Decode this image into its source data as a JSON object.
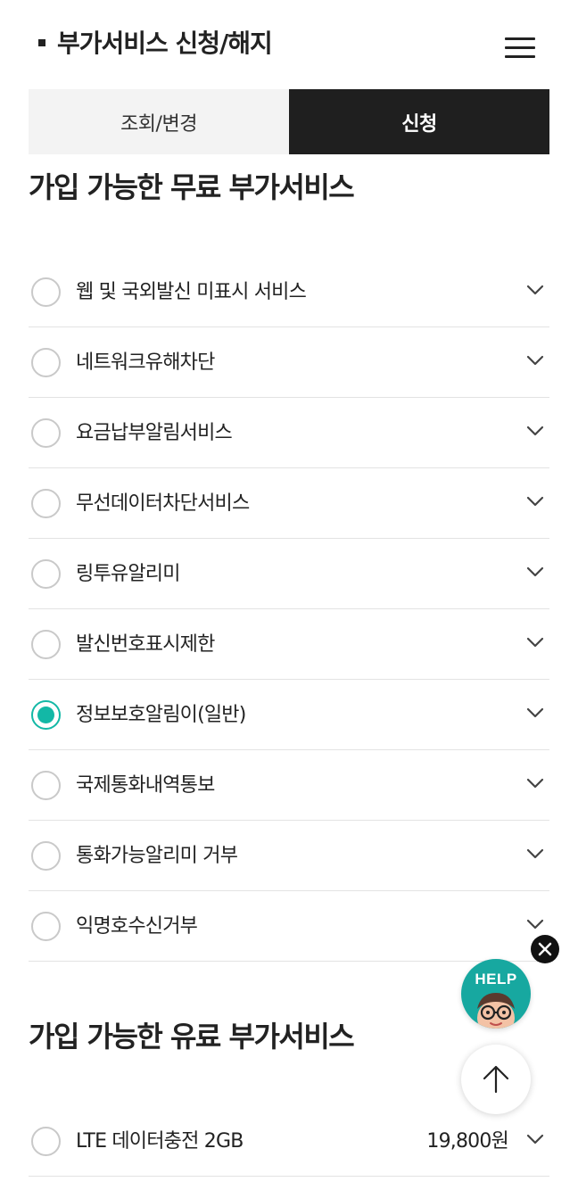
{
  "header": {
    "title": "부가서비스 신청/해지",
    "menu_icon": "hamburger-menu-icon"
  },
  "tabs": [
    {
      "label": "조회/변경",
      "active": false
    },
    {
      "label": "신청",
      "active": true
    }
  ],
  "free_section": {
    "title": "가입 가능한 무료 부가서비스",
    "items": [
      {
        "label": "웹 및 국외발신 미표시 서비스",
        "checked": false
      },
      {
        "label": "네트워크유해차단",
        "checked": false
      },
      {
        "label": "요금납부알림서비스",
        "checked": false
      },
      {
        "label": "무선데이터차단서비스",
        "checked": false
      },
      {
        "label": "링투유알리미",
        "checked": false
      },
      {
        "label": "발신번호표시제한",
        "checked": false
      },
      {
        "label": "정보보호알림이(일반)",
        "checked": true
      },
      {
        "label": "국제통화내역통보",
        "checked": false
      },
      {
        "label": "통화가능알리미 거부",
        "checked": false
      },
      {
        "label": "익명호수신거부",
        "checked": false
      }
    ]
  },
  "paid_section": {
    "title": "가입 가능한 유료 부가서비스",
    "items": [
      {
        "label": "LTE 데이터충전 2GB",
        "price": "19,800원",
        "checked": false
      }
    ]
  },
  "floating": {
    "help_label": "HELP",
    "close_icon": "close-icon",
    "top_icon": "arrow-up-icon"
  },
  "colors": {
    "accent": "#13b8a6",
    "help_bg": "#17a8a0",
    "active_tab": "#1f1f1f"
  }
}
